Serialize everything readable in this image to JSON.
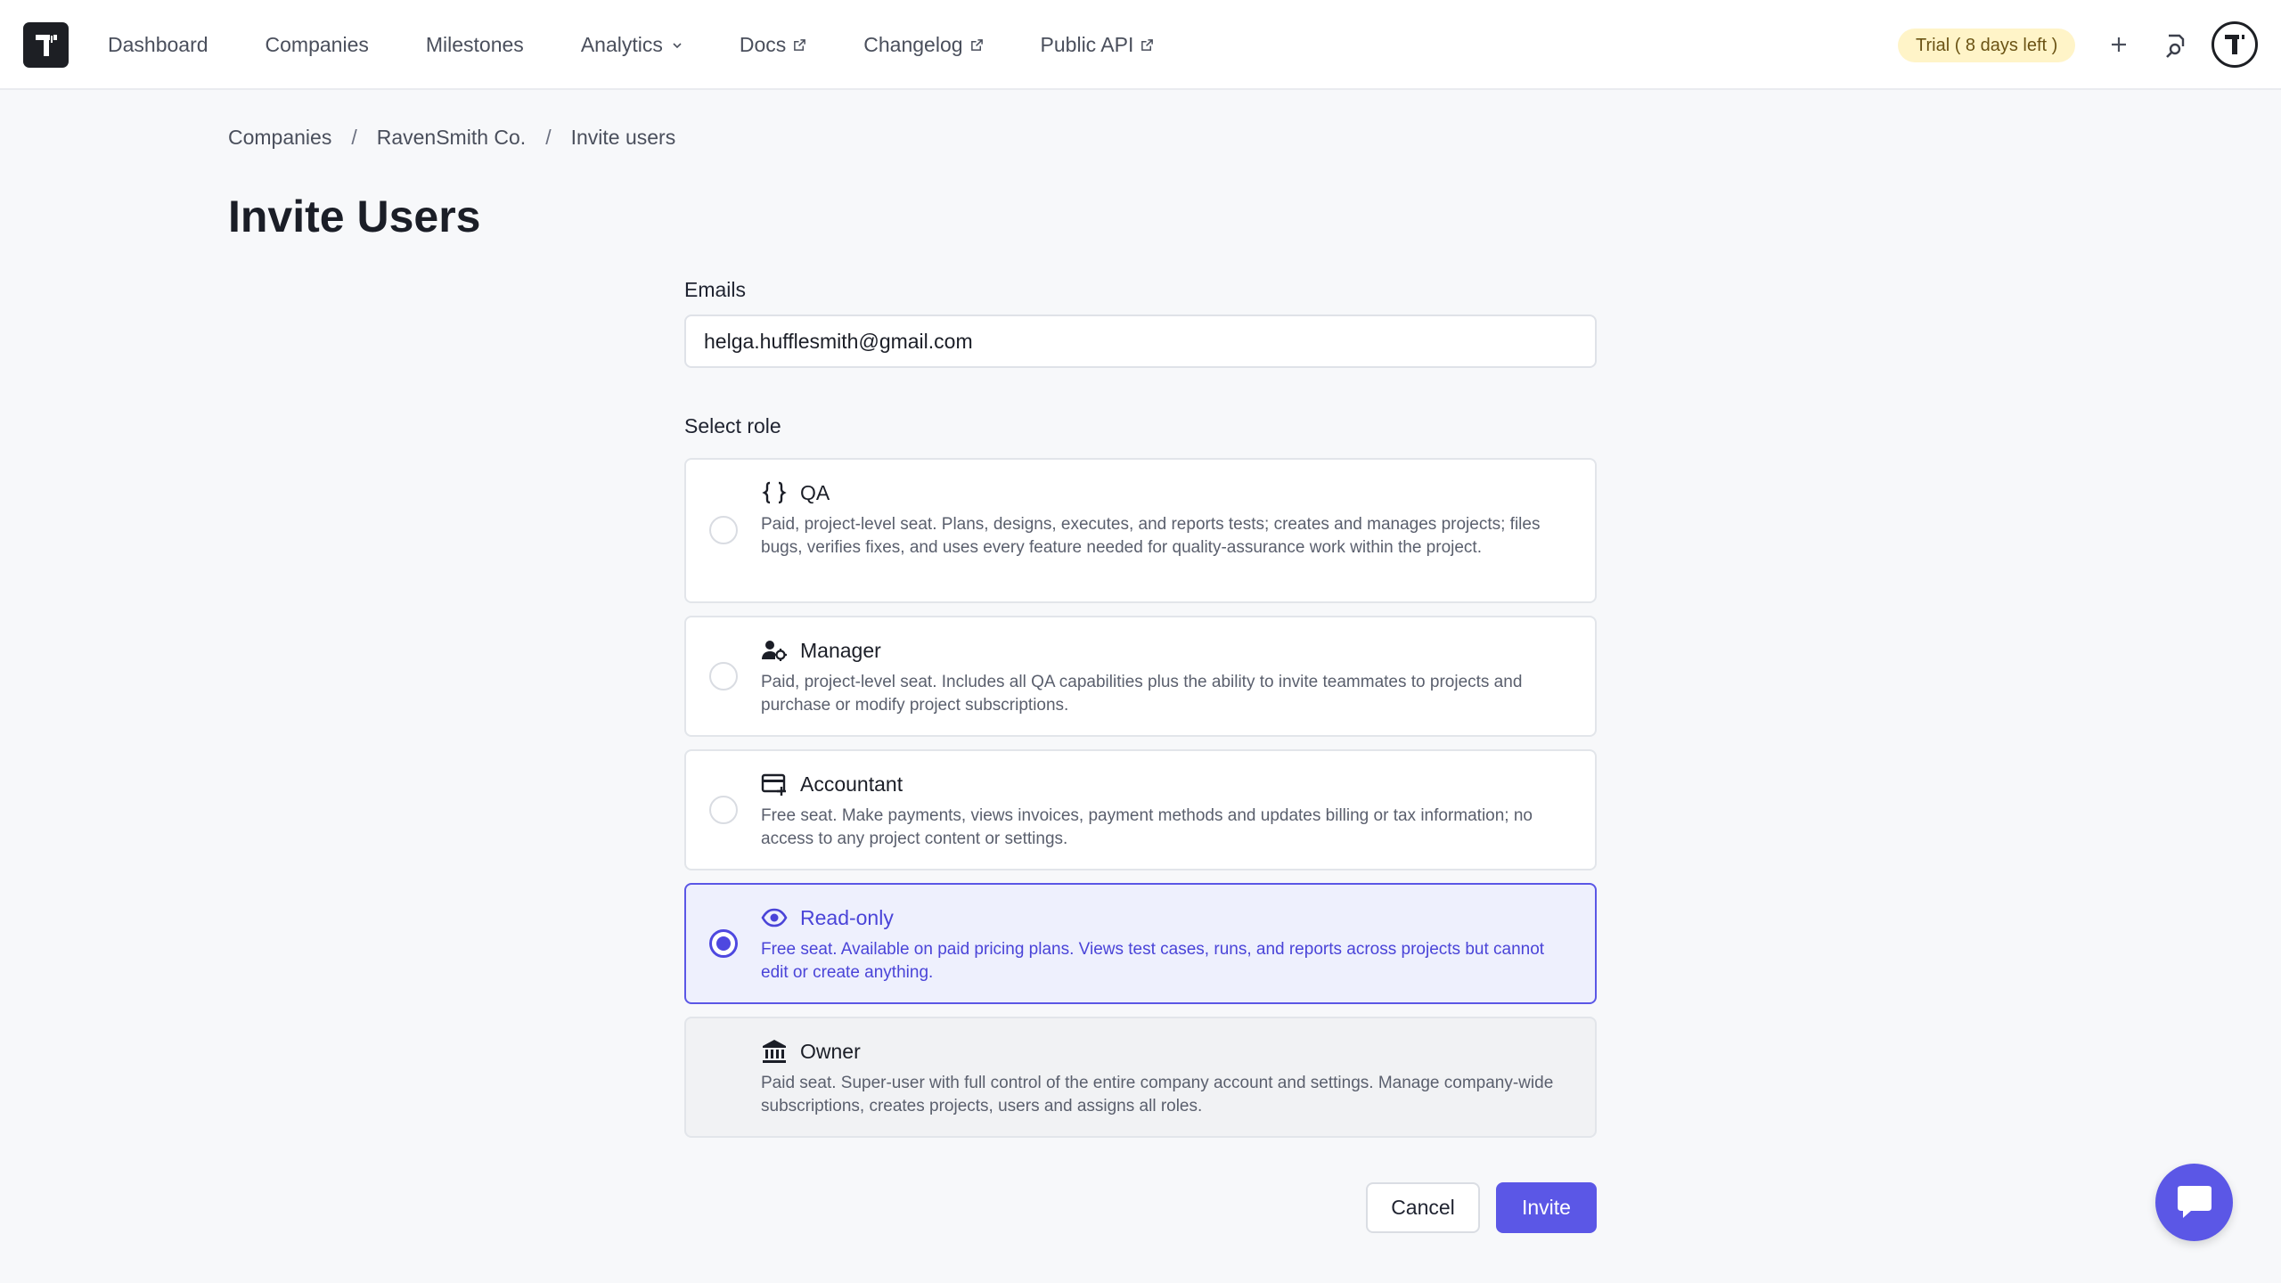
{
  "nav": {
    "items": [
      {
        "label": "Dashboard"
      },
      {
        "label": "Companies"
      },
      {
        "label": "Milestones"
      },
      {
        "label": "Analytics"
      },
      {
        "label": "Docs"
      },
      {
        "label": "Changelog"
      },
      {
        "label": "Public API"
      }
    ],
    "trial_badge": "Trial ( 8 days left )"
  },
  "breadcrumb": {
    "items": [
      "Companies",
      "RavenSmith Co.",
      "Invite users"
    ],
    "separator": "/"
  },
  "page": {
    "title": "Invite Users"
  },
  "form": {
    "emails_label": "Emails",
    "emails_value": "helga.hufflesmith@gmail.com",
    "role_label": "Select role",
    "roles": [
      {
        "title": "QA",
        "icon": "braces-icon",
        "description": "Paid, project-level seat. Plans, designs, executes, and reports tests; creates and manages projects; files bugs, verifies fixes, and uses every feature needed for quality-assurance work within the project.",
        "state": "unselected"
      },
      {
        "title": "Manager",
        "icon": "user-gear-icon",
        "description": "Paid, project-level seat. Includes all QA capabilities plus the ability to invite teammates to projects and purchase or modify project subscriptions.",
        "state": "unselected"
      },
      {
        "title": "Accountant",
        "icon": "card-plus-icon",
        "description": "Free seat. Make payments, views invoices, payment methods and updates billing or tax information; no access to any project content or settings.",
        "state": "unselected"
      },
      {
        "title": "Read-only",
        "icon": "eye-icon",
        "description": "Free seat. Available on paid pricing plans. Views test cases, runs, and reports across projects but cannot edit or create anything.",
        "state": "selected"
      },
      {
        "title": "Owner",
        "icon": "bank-icon",
        "description": "Paid seat. Super-user with full control of the entire company account and settings. Manage company-wide subscriptions, creates projects, users and assigns all roles.",
        "state": "disabled"
      }
    ],
    "cancel_label": "Cancel",
    "invite_label": "Invite"
  },
  "colors": {
    "accent": "#5b57e6",
    "selected_bg": "#eef0fd",
    "trial_bg": "#fff4c8"
  }
}
